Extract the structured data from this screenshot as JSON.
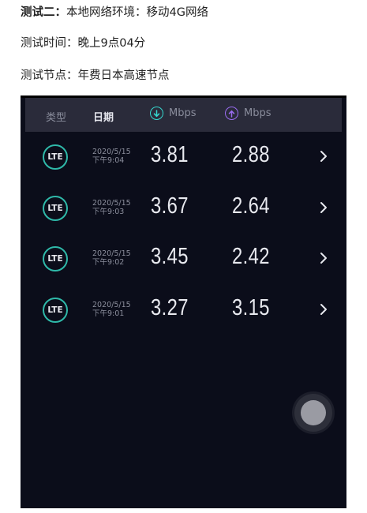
{
  "article": {
    "line1_label": "测试二：",
    "line1_text": "本地网络环境：移动4G网络",
    "line2_text": "测试时间：晚上9点04分",
    "line3_text": "测试节点：年费日本高速节点"
  },
  "header": {
    "type_label": "类型",
    "date_label": "日期",
    "download_unit": "Mbps",
    "upload_unit": "Mbps",
    "download_icon": "arrow-down-circle-icon",
    "upload_icon": "arrow-up-circle-icon"
  },
  "colors": {
    "download_accent": "#35d7cf",
    "upload_accent": "#9a6cf0",
    "badge_ring": "#2fb9a9",
    "app_background": "#0b0d1a",
    "header_background": "#2a2b3a"
  },
  "results": [
    {
      "badge": "LTE",
      "date": "2020/5/15",
      "time": "下午9:04",
      "download": "3.81",
      "upload": "2.88"
    },
    {
      "badge": "LTE",
      "date": "2020/5/15",
      "time": "下午9:03",
      "download": "3.67",
      "upload": "2.64"
    },
    {
      "badge": "LTE",
      "date": "2020/5/15",
      "time": "下午9:02",
      "download": "3.45",
      "upload": "2.42"
    },
    {
      "badge": "LTE",
      "date": "2020/5/15",
      "time": "下午9:01",
      "download": "3.27",
      "upload": "3.15"
    }
  ]
}
